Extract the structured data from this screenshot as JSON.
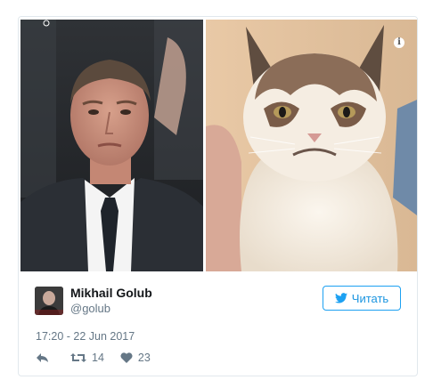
{
  "tweet": {
    "author_name": "Mikhail Golub",
    "author_handle": "@golub",
    "follow_label": "Читать",
    "timestamp": "17:20 - 22 Jun 2017",
    "retweet_count": "14",
    "like_count": "23",
    "info_glyph": "i"
  },
  "icons": {
    "info": "info-icon",
    "twitter": "twitter-bird-icon",
    "reply": "reply-icon",
    "retweet": "retweet-icon",
    "like": "heart-icon"
  },
  "colors": {
    "accent": "#1da1f2",
    "muted": "#657786",
    "text": "#14171a",
    "border": "#e1e8ed"
  }
}
